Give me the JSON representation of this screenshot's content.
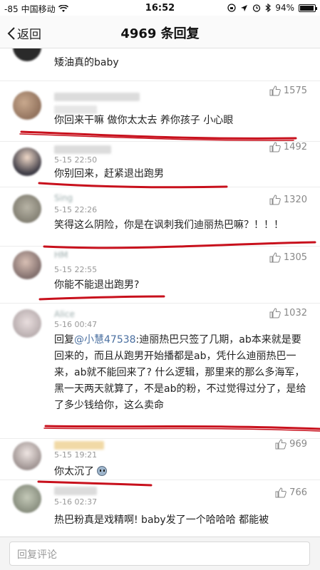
{
  "status_bar": {
    "signal": "-85",
    "carrier": "中国移动",
    "time": "16:52",
    "battery": "94%",
    "battery_level": 0.94
  },
  "nav": {
    "back_label": "返回",
    "title": "4969 条回复"
  },
  "comments": [
    {
      "text": "矮油真的baby"
    },
    {
      "likes": "1575",
      "text": "你回来干嘛  做你太太去  养你孩子  小心眼"
    },
    {
      "time": "5-15 22:50",
      "likes": "1492",
      "text": "你别回来，赶紧退出跑男"
    },
    {
      "name": "Sing",
      "time": "5-15 22:26",
      "likes": "1320",
      "text": "笑得这么阴险，你是在讽刺我们迪丽热巴嘛？！！！"
    },
    {
      "name": "HM",
      "time": "5-15 22:55",
      "likes": "1305",
      "text": "你能不能退出跑男?"
    },
    {
      "name": "Alice",
      "time": "5-16 00:47",
      "likes": "1032",
      "reply_prefix": "回复",
      "mention": "@小慧47538",
      "text": ":迪丽热巴只签了几期，ab本来就是要回来的，而且从跑男开始播都是ab，凭什么迪丽热巴一来，ab就不能回来了? 什么逻辑，那里来的那么多海军，黑一天两天就算了，不是ab的粉，不过觉得过分了，是给了多少钱给你，这么卖命"
    },
    {
      "time": "5-15 19:21",
      "likes": "969",
      "text": "你太沉了"
    },
    {
      "time": "5-16 02:37",
      "likes": "766",
      "text": "热巴粉真是戏精啊!   baby发了一个哈哈哈  都能被"
    }
  ],
  "input": {
    "placeholder": "回复评论"
  },
  "colors": {
    "ink": "#c8101c",
    "mention": "#4a6fa0"
  }
}
